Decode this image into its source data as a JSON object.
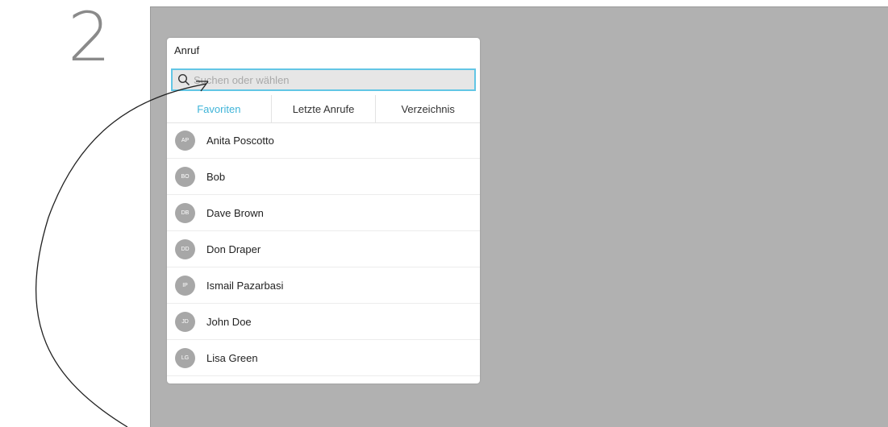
{
  "step": {
    "number": "2"
  },
  "dialog": {
    "title": "Anruf",
    "search": {
      "placeholder": "Suchen oder wählen",
      "value": "",
      "icon": "search-icon"
    },
    "tabs": [
      {
        "label": "Favoriten",
        "active": true
      },
      {
        "label": "Letzte Anrufe",
        "active": false
      },
      {
        "label": "Verzeichnis",
        "active": false
      }
    ],
    "contacts": [
      {
        "initials": "AP",
        "name": "Anita Poscotto"
      },
      {
        "initials": "BO",
        "name": "Bob"
      },
      {
        "initials": "DB",
        "name": "Dave Brown"
      },
      {
        "initials": "DD",
        "name": "Don Draper"
      },
      {
        "initials": "IP",
        "name": "Ismail Pazarbasi"
      },
      {
        "initials": "JD",
        "name": "John Doe"
      },
      {
        "initials": "LG",
        "name": "Lisa Green"
      }
    ]
  },
  "colors": {
    "accent": "#3fb4d8",
    "search_border": "#62c6e5",
    "screen_background": "#b1b1b1",
    "avatar": "#a7a7a7"
  }
}
